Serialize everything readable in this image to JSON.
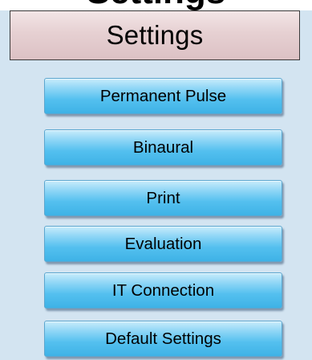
{
  "top_partial_text": "Settings",
  "panel": {
    "title": "Settings"
  },
  "buttons": [
    {
      "label": "Permanent Pulse"
    },
    {
      "label": "Binaural"
    },
    {
      "label": "Print"
    },
    {
      "label": "Evaluation"
    },
    {
      "label": "IT Connection"
    },
    {
      "label": "Default Settings"
    }
  ],
  "colors": {
    "panel_background": "#d3e4f1",
    "header_background": "#e6d0d2",
    "button_top": "#c9ecfb",
    "button_bottom": "#3eb2e6"
  }
}
